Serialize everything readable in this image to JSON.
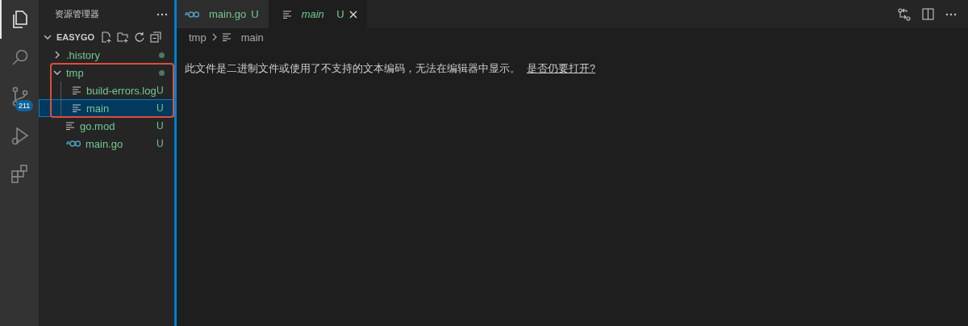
{
  "activity_bar": {
    "items": [
      {
        "kind": "explorer",
        "selected": true
      },
      {
        "kind": "search",
        "selected": false
      },
      {
        "kind": "scm",
        "selected": false,
        "badge": "211"
      },
      {
        "kind": "debug",
        "selected": false
      },
      {
        "kind": "extensions",
        "selected": false
      }
    ]
  },
  "sidebar": {
    "title": "资源管理器",
    "root": {
      "label": "EASYGO",
      "expanded": true,
      "children": [
        {
          "label": ".history",
          "kind": "folder",
          "expanded": false,
          "modified": true,
          "selected": false
        },
        {
          "label": "tmp",
          "kind": "folder",
          "expanded": true,
          "modified": true,
          "selected": false,
          "highlighted": true,
          "children": [
            {
              "label": "build-errors.log",
              "kind": "text",
              "status": "U",
              "selected": false
            },
            {
              "label": "main",
              "kind": "text",
              "status": "U",
              "selected": true
            }
          ]
        },
        {
          "label": "go.mod",
          "kind": "text",
          "status": "U",
          "selected": false
        },
        {
          "label": "main.go",
          "kind": "go",
          "status": "U",
          "selected": false
        }
      ]
    }
  },
  "tabs": [
    {
      "label": "main.go",
      "kind": "go",
      "status": "U",
      "selected": false,
      "preview": false
    },
    {
      "label": "main",
      "kind": "text",
      "status": "U",
      "selected": true,
      "preview": true
    }
  ],
  "breadcrumb": [
    "tmp",
    "main"
  ],
  "message": {
    "text": "此文件是二进制文件或使用了不支持的文本编码，无法在编辑器中显示。",
    "link": "是否仍要打开?"
  }
}
